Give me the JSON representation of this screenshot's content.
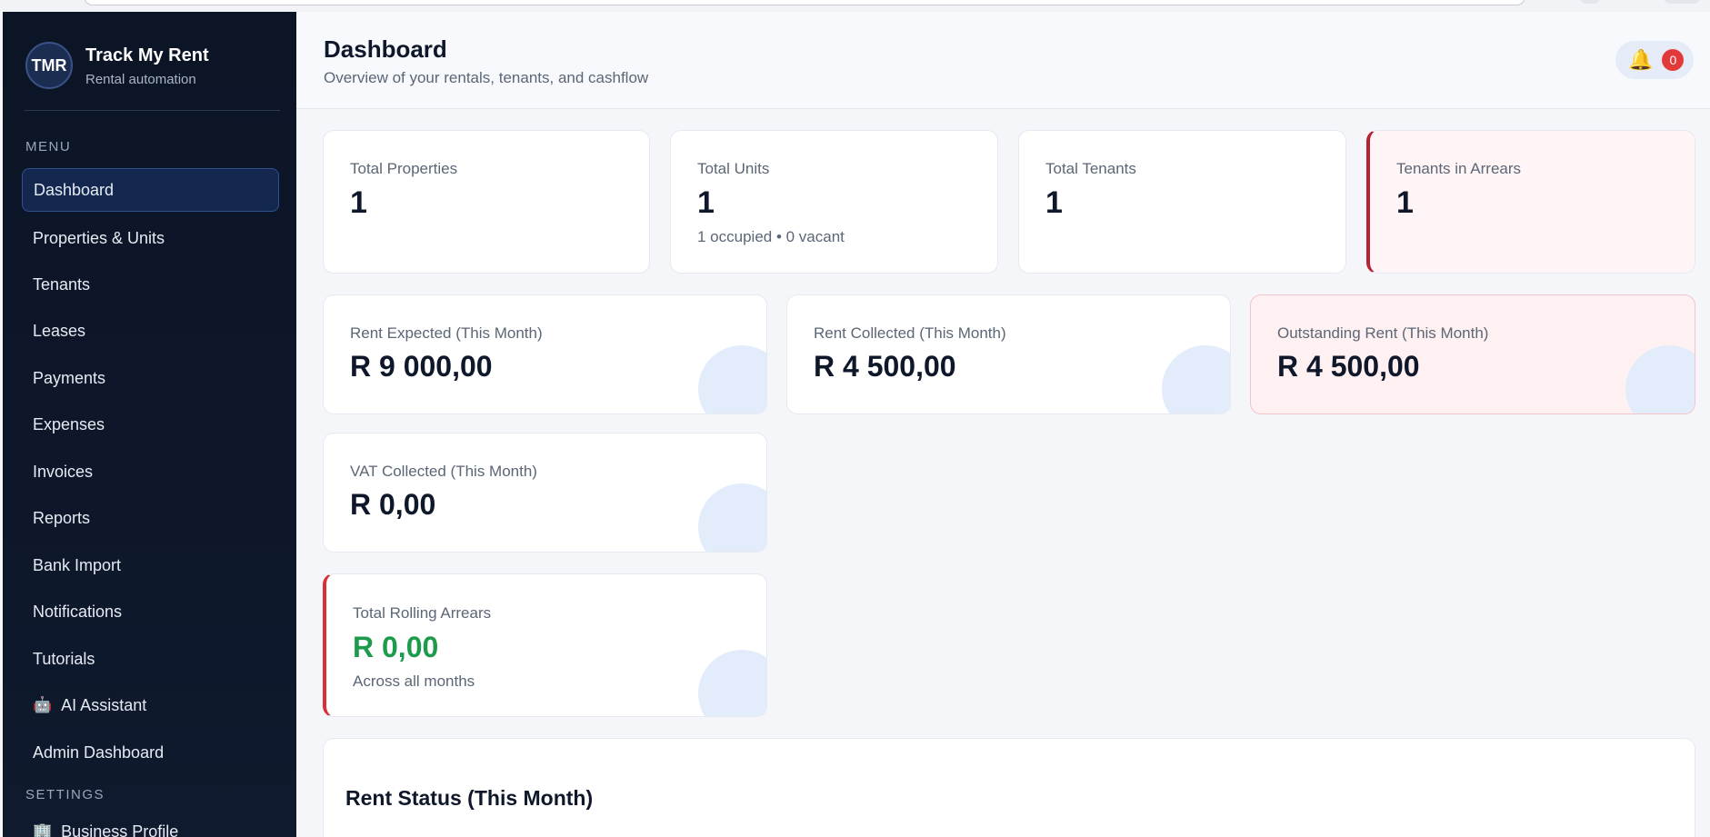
{
  "brand": {
    "logo": "TMR",
    "name": "Track My Rent",
    "subtitle": "Rental automation"
  },
  "sidebar": {
    "menu_label": "MENU",
    "items": [
      {
        "label": "Dashboard",
        "active": true
      },
      {
        "label": "Properties & Units"
      },
      {
        "label": "Tenants"
      },
      {
        "label": "Leases"
      },
      {
        "label": "Payments"
      },
      {
        "label": "Expenses"
      },
      {
        "label": "Invoices"
      },
      {
        "label": "Reports"
      },
      {
        "label": "Bank Import"
      },
      {
        "label": "Notifications"
      },
      {
        "label": "Tutorials"
      },
      {
        "label": "AI Assistant",
        "icon": "robot-icon",
        "emoji": "🤖"
      },
      {
        "label": "Admin Dashboard"
      }
    ],
    "settings_label": "SETTINGS",
    "settings_items": [
      {
        "label": "Business Profile",
        "icon": "building-icon",
        "emoji": "🏢"
      }
    ]
  },
  "header": {
    "title": "Dashboard",
    "subtitle": "Overview of your rentals, tenants, and cashflow",
    "notifications": {
      "icon": "bell-icon",
      "count": "0"
    }
  },
  "stats": {
    "total_properties": {
      "label": "Total Properties",
      "value": "1"
    },
    "total_units": {
      "label": "Total Units",
      "value": "1",
      "note": "1 occupied • 0 vacant"
    },
    "total_tenants": {
      "label": "Total Tenants",
      "value": "1"
    },
    "tenants_in_arrears": {
      "label": "Tenants in Arrears",
      "value": "1"
    }
  },
  "finance": {
    "rent_expected": {
      "label": "Rent Expected (This Month)",
      "value": "R 9 000,00"
    },
    "rent_collected": {
      "label": "Rent Collected (This Month)",
      "value": "R 4 500,00"
    },
    "outstanding_rent": {
      "label": "Outstanding Rent (This Month)",
      "value": "R 4 500,00"
    },
    "vat_collected": {
      "label": "VAT Collected (This Month)",
      "value": "R 0,00"
    },
    "rolling_arrears": {
      "label": "Total Rolling Arrears",
      "value": "R 0,00",
      "note": "Across all months"
    }
  },
  "rent_status": {
    "title": "Rent Status (This Month)"
  },
  "colors": {
    "sidebar_bg": "#0e172a",
    "accent_active": "#14284f",
    "arrears_red": "#b5232f",
    "positive_green": "#1d9a4b",
    "badge_red": "#e23a3a"
  }
}
